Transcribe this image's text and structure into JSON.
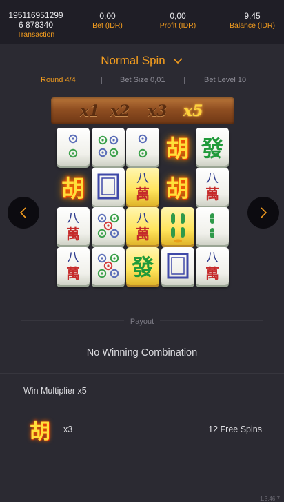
{
  "topbar": {
    "transaction": {
      "value": "1951169512996 878340",
      "label": "Transaction"
    },
    "bet": {
      "value": "0,00",
      "label": "Bet (IDR)"
    },
    "profit": {
      "value": "0,00",
      "label": "Profit (IDR)"
    },
    "balance": {
      "value": "9,45",
      "label": "Balance (IDR)"
    }
  },
  "mode": {
    "label": "Normal Spin",
    "icon": "chevron-down-icon"
  },
  "info": {
    "round": "Round 4/4",
    "bet_size": "Bet Size 0,01",
    "bet_level": "Bet Level 10"
  },
  "multipliers": [
    {
      "label": "x1",
      "active": false
    },
    {
      "label": "x2",
      "active": false
    },
    {
      "label": "x3",
      "active": false
    },
    {
      "label": "x5",
      "active": true
    }
  ],
  "board": {
    "columns": [
      [
        "two-dots",
        "hu-fire",
        "eight-wan",
        "eight-wan"
      ],
      [
        "four-dots",
        "white-dragon",
        "five-dots",
        "five-dots"
      ],
      [
        "two-dots",
        "eight-wan-gold",
        "eight-wan-gold",
        "green-fa-gold"
      ],
      [
        "hu-fire",
        "hu-fire",
        "four-bamboo-gold",
        "white-dragon"
      ],
      [
        "green-fa",
        "eight-wan",
        "two-bamboo",
        "eight-wan"
      ]
    ]
  },
  "nav": {
    "prev_icon": "chevron-left-icon",
    "next_icon": "chevron-right-icon"
  },
  "payout": {
    "label": "Payout",
    "result": "No Winning Combination"
  },
  "win_multiplier": "Win Multiplier x5",
  "payline": {
    "symbol": "hu-fire",
    "count": "x3",
    "reward": "12 Free Spins"
  },
  "version": "1.3.46.7",
  "colors": {
    "accent": "#f29c1f",
    "background": "#2b2a32",
    "topbar": "#1f1e26"
  }
}
